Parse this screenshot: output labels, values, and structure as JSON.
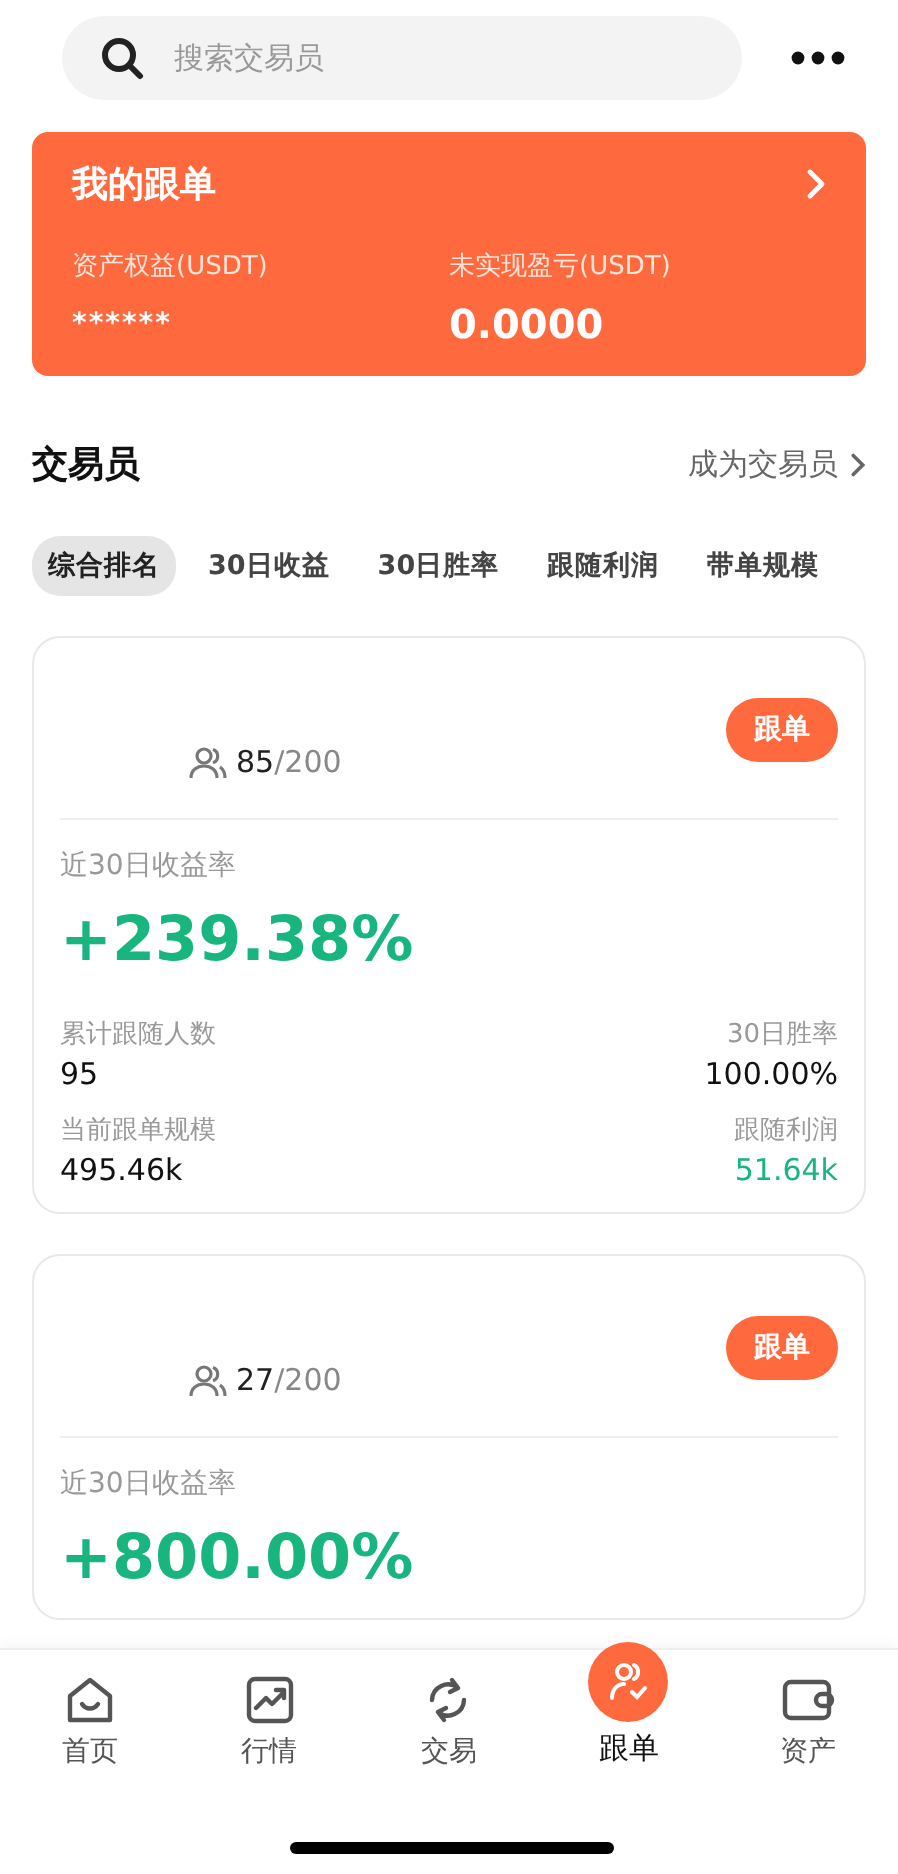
{
  "search": {
    "placeholder": "搜索交易员"
  },
  "summary": {
    "title": "我的跟单",
    "fields": [
      {
        "label": "资产权益(USDT)",
        "value": "******"
      },
      {
        "label": "未实现盈亏(USDT)",
        "value": "0.0000"
      }
    ]
  },
  "section": {
    "title": "交易员",
    "link": "成为交易员"
  },
  "tabs": [
    {
      "label": "综合排名",
      "selected": true
    },
    {
      "label": "30日收益",
      "selected": false
    },
    {
      "label": "30日胜率",
      "selected": false
    },
    {
      "label": "跟随利润",
      "selected": false
    },
    {
      "label": "带单规模",
      "selected": false
    }
  ],
  "traders": [
    {
      "followers": "85",
      "capacity": "/200",
      "button": "跟单",
      "roi_label": "近30日收益率",
      "roi": "+239.38%",
      "stats": [
        {
          "label": "累计跟随人数",
          "value": "95",
          "positive": false
        },
        {
          "label": "30日胜率",
          "value": "100.00%",
          "positive": false
        },
        {
          "label": "当前跟单规模",
          "value": "495.46k",
          "positive": false
        },
        {
          "label": "跟随利润",
          "value": "51.64k",
          "positive": true
        }
      ]
    },
    {
      "followers": "27",
      "capacity": "/200",
      "button": "跟单",
      "roi_label": "近30日收益率",
      "roi": "+800.00%"
    }
  ],
  "nav": [
    {
      "kind": "home",
      "label": "首页",
      "selected": false
    },
    {
      "kind": "market",
      "label": "行情",
      "selected": false
    },
    {
      "kind": "trade",
      "label": "交易",
      "selected": false
    },
    {
      "kind": "copy",
      "label": "跟单",
      "selected": true
    },
    {
      "kind": "assets",
      "label": "资产",
      "selected": false
    }
  ]
}
